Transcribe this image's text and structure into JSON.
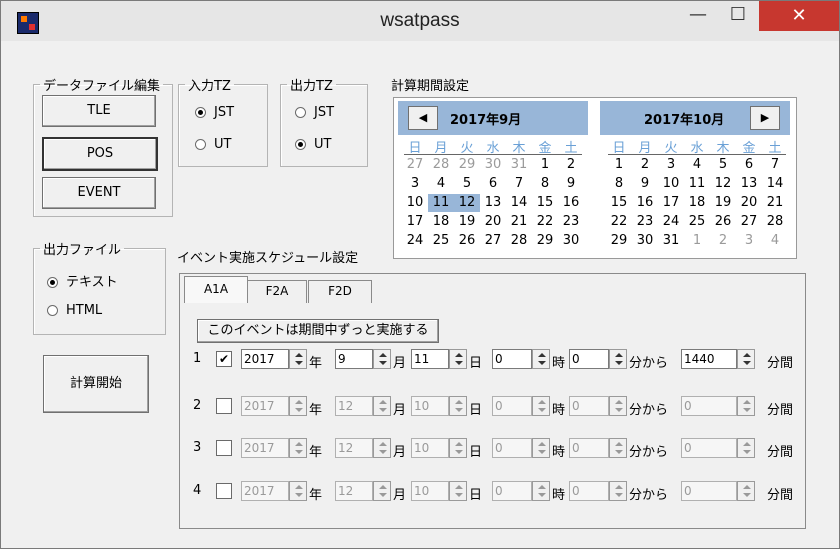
{
  "window": {
    "title": "wsatpass",
    "min_label": "—",
    "max_label": "☐",
    "close_label": "✕"
  },
  "data_file_edit": {
    "legend": "データファイル編集",
    "buttons": [
      "TLE",
      "POS",
      "EVENT"
    ]
  },
  "input_tz": {
    "legend": "入力TZ",
    "options": [
      "JST",
      "UT"
    ],
    "selected": "JST"
  },
  "output_tz": {
    "legend": "出力TZ",
    "options": [
      "JST",
      "UT"
    ],
    "selected": "UT"
  },
  "output_file": {
    "legend": "出力ファイル",
    "options": [
      "テキスト",
      "HTML"
    ],
    "selected": "テキスト"
  },
  "start_button": "計算開始",
  "calc_period": {
    "label": "計算期間設定",
    "weekdays": [
      "日",
      "月",
      "火",
      "水",
      "木",
      "金",
      "土"
    ],
    "left_month": {
      "title": "2017年9月",
      "nav": "◀",
      "days": [
        "27",
        "28",
        "29",
        "30",
        "31",
        "1",
        "2",
        "3",
        "4",
        "5",
        "6",
        "7",
        "8",
        "9",
        "10",
        "11",
        "12",
        "13",
        "14",
        "15",
        "16",
        "17",
        "18",
        "19",
        "20",
        "21",
        "22",
        "23",
        "24",
        "25",
        "26",
        "27",
        "28",
        "29",
        "30"
      ]
    },
    "right_month": {
      "title": "2017年10月",
      "nav": "▶",
      "days": [
        "1",
        "2",
        "3",
        "4",
        "5",
        "6",
        "7",
        "8",
        "9",
        "10",
        "11",
        "12",
        "13",
        "14",
        "15",
        "16",
        "17",
        "18",
        "19",
        "20",
        "21",
        "22",
        "23",
        "24",
        "25",
        "26",
        "27",
        "28",
        "29",
        "30",
        "31",
        "1",
        "2",
        "3",
        "4"
      ]
    }
  },
  "schedule": {
    "label": "イベント実施スケジュール設定",
    "tabs": [
      "A1A",
      "F2A",
      "F2D"
    ],
    "all_period_button": "このイベントは期間中ずっと実施する",
    "units": {
      "year": "年",
      "month": "月",
      "day": "日",
      "hour": "時",
      "minute_from": "分から",
      "minutes": "分間"
    },
    "rows": [
      {
        "num": "1",
        "checked": "✔",
        "year": "2017",
        "month": "9",
        "day": "11",
        "hour": "0",
        "minute": "0",
        "duration": "1440"
      },
      {
        "num": "2",
        "checked": "",
        "year": "2017",
        "month": "12",
        "day": "10",
        "hour": "0",
        "minute": "0",
        "duration": "0"
      },
      {
        "num": "3",
        "checked": "",
        "year": "2017",
        "month": "12",
        "day": "10",
        "hour": "0",
        "minute": "0",
        "duration": "0"
      },
      {
        "num": "4",
        "checked": "",
        "year": "2017",
        "month": "12",
        "day": "10",
        "hour": "0",
        "minute": "0",
        "duration": "0"
      }
    ]
  }
}
